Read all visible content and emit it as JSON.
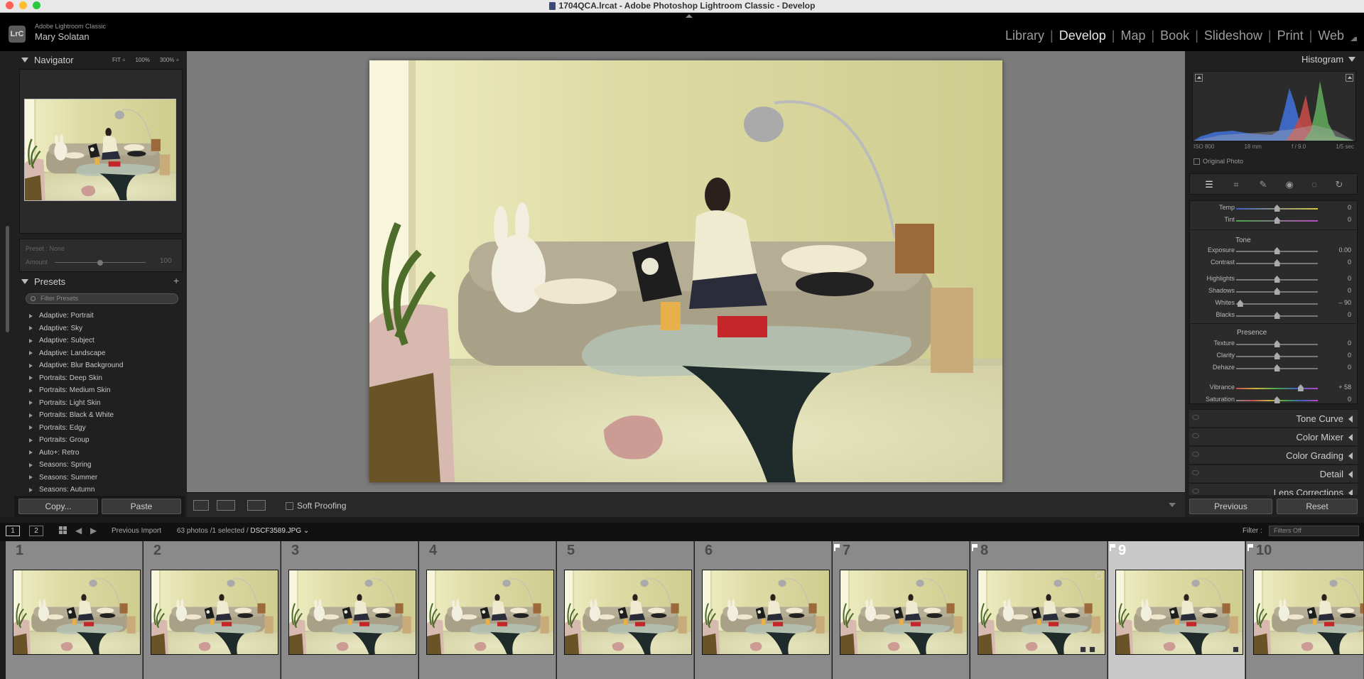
{
  "window": {
    "title": "1704QCA.lrcat - Adobe Photoshop Lightroom Classic - Develop",
    "colors": {
      "close": "#ff5f57",
      "minimize": "#febc2e",
      "zoom": "#28c840"
    }
  },
  "identity": {
    "logo": "LrC",
    "app": "Adobe Lightroom Classic",
    "user": "Mary Solatan"
  },
  "modules": [
    {
      "label": "Library",
      "active": false
    },
    {
      "label": "Develop",
      "active": true
    },
    {
      "label": "Map",
      "active": false
    },
    {
      "label": "Book",
      "active": false
    },
    {
      "label": "Slideshow",
      "active": false
    },
    {
      "label": "Print",
      "active": false
    },
    {
      "label": "Web",
      "active": false
    }
  ],
  "navigator": {
    "title": "Navigator",
    "zooms": [
      "FIT ÷",
      "100%",
      "300% ÷"
    ]
  },
  "preset_info": {
    "preset": "Preset : None",
    "amount_label": "Amount",
    "amount_value": "100",
    "amount_fraction": 1.0
  },
  "presets": {
    "title": "Presets",
    "plus": "+",
    "filter_placeholder": "Filter Presets",
    "items": [
      "Adaptive: Portrait",
      "Adaptive: Sky",
      "Adaptive: Subject",
      "Adaptive: Landscape",
      "Adaptive: Blur Background",
      "Portraits: Deep Skin",
      "Portraits: Medium Skin",
      "Portraits: Light Skin",
      "Portraits: Black & White",
      "Portraits: Edgy",
      "Portraits: Group",
      "Auto+: Retro",
      "Seasons: Spring",
      "Seasons: Summer",
      "Seasons: Autumn"
    ]
  },
  "left_buttons": {
    "copy": "Copy...",
    "paste": "Paste"
  },
  "toolbar": {
    "soft_proofing": "Soft Proofing"
  },
  "histogram": {
    "title": "Histogram",
    "exif": [
      "ISO 800",
      "18 mm",
      "f / 9.0",
      "1/5 sec"
    ],
    "original_photo": "Original Photo"
  },
  "develop": {
    "temp": {
      "label": "Temp",
      "value": "0",
      "pos": 0.5
    },
    "tint": {
      "label": "Tint",
      "value": "0",
      "pos": 0.5
    },
    "tone_title": "Tone",
    "tone": [
      {
        "label": "Exposure",
        "value": "0.00",
        "pos": 0.5
      },
      {
        "label": "Contrast",
        "value": "0",
        "pos": 0.5
      },
      {
        "label": "Highlights",
        "value": "0",
        "pos": 0.5
      },
      {
        "label": "Shadows",
        "value": "0",
        "pos": 0.5
      },
      {
        "label": "Whites",
        "value": "– 90",
        "pos": 0.05
      },
      {
        "label": "Blacks",
        "value": "0",
        "pos": 0.5
      }
    ],
    "presence_title": "Presence",
    "presence": [
      {
        "label": "Texture",
        "value": "0",
        "pos": 0.5
      },
      {
        "label": "Clarity",
        "value": "0",
        "pos": 0.5
      },
      {
        "label": "Dehaze",
        "value": "0",
        "pos": 0.5
      },
      {
        "label": "Vibrance",
        "value": "+ 58",
        "pos": 0.79
      },
      {
        "label": "Saturation",
        "value": "0",
        "pos": 0.5
      }
    ]
  },
  "collapsed_panels": [
    "Tone Curve",
    "Color Mixer",
    "Color Grading",
    "Detail",
    "Lens Corrections"
  ],
  "right_buttons": {
    "previous": "Previous",
    "reset": "Reset"
  },
  "filmstrip_bar": {
    "views": [
      "1",
      "2"
    ],
    "source": "Previous Import",
    "count": "63 photos /1 selected /",
    "filename": "DSCF3589.JPG ⌄",
    "filter_label": "Filter :",
    "filter_value": "Filters Off"
  },
  "filmstrip": [
    {
      "num": "1",
      "flag": false,
      "selected": false
    },
    {
      "num": "2",
      "flag": false,
      "selected": false
    },
    {
      "num": "3",
      "flag": false,
      "selected": false
    },
    {
      "num": "4",
      "flag": false,
      "selected": false
    },
    {
      "num": "5",
      "flag": false,
      "selected": false
    },
    {
      "num": "6",
      "flag": false,
      "selected": false
    },
    {
      "num": "7",
      "flag": true,
      "selected": false
    },
    {
      "num": "8",
      "flag": true,
      "selected": false
    },
    {
      "num": "9",
      "flag": true,
      "selected": true
    },
    {
      "num": "10",
      "flag": true,
      "selected": false
    }
  ]
}
